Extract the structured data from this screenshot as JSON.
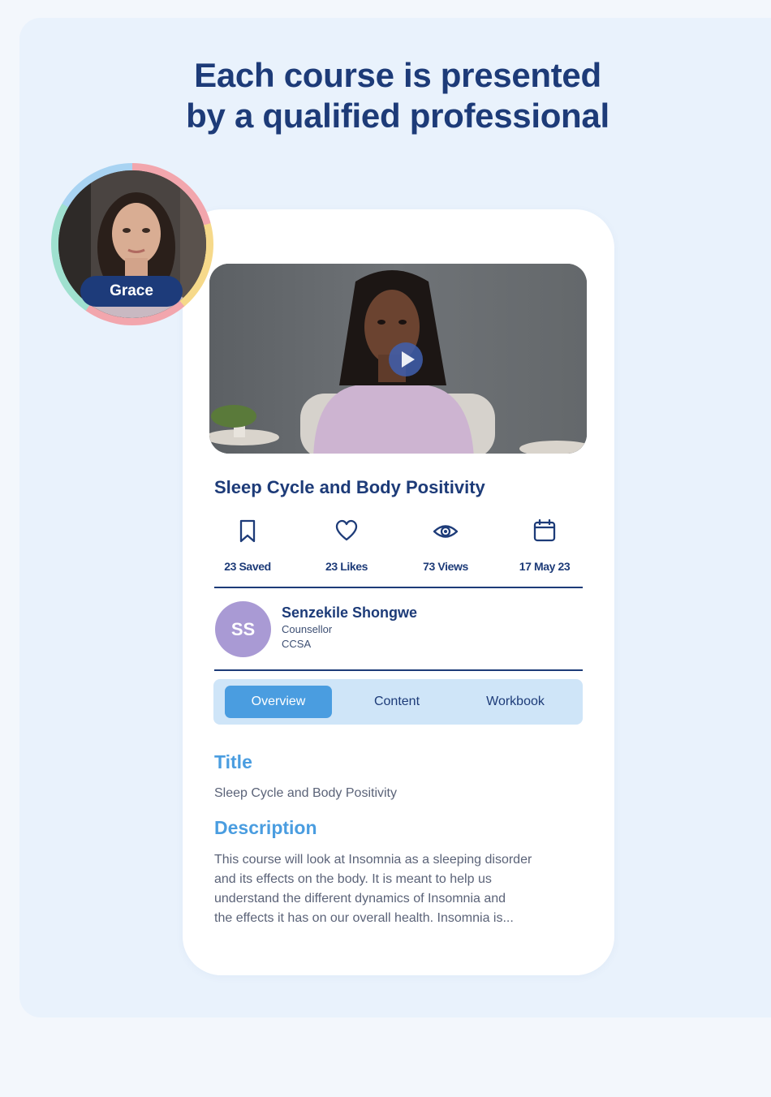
{
  "headline": {
    "line1": "Each course is presented",
    "line2": "by a qualified professional"
  },
  "presenter": {
    "name": "Grace"
  },
  "course": {
    "title": "Sleep Cycle and Body Positivity",
    "stats": [
      {
        "icon": "bookmark-icon",
        "label": "23 Saved"
      },
      {
        "icon": "heart-icon",
        "label": "23 Likes"
      },
      {
        "icon": "eye-icon",
        "label": "73 Views"
      },
      {
        "icon": "calendar-icon",
        "label": "17 May 23"
      }
    ]
  },
  "author": {
    "initials": "SS",
    "name": "Senzekile Shongwe",
    "role": "Counsellor",
    "org": "CCSA"
  },
  "tabs": [
    {
      "label": "Overview",
      "active": true
    },
    {
      "label": "Content",
      "active": false
    },
    {
      "label": "Workbook",
      "active": false
    }
  ],
  "overview": {
    "title_heading": "Title",
    "title_value": "Sleep Cycle and Body Positivity",
    "description_heading": "Description",
    "description_lines": [
      "This course will look at Insomnia as a sleeping disorder",
      "and its effects on the body. It is meant to help us",
      "understand the different dynamics of Insomnia and",
      "the effects it has on our overall health. Insomnia is..."
    ]
  },
  "colors": {
    "navy": "#1d3b78",
    "accent_blue": "#4a9de0",
    "tab_bar": "#cfe5f8",
    "avatar": "#a99ad4",
    "panel_bg": "#e9f2fc"
  }
}
